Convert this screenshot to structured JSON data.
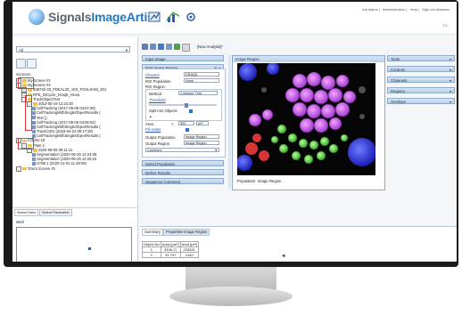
{
  "header": {
    "logo_word1": "Signals",
    "logo_word2": "ImageArtist",
    "top_links": [
      "Job status",
      "Administration",
      "Help",
      "Sign out dhaslam"
    ],
    "user_id": "0.1"
  },
  "left_panel": {
    "dropdown_value": "All",
    "screens_label": "Screens",
    "tree": [
      {
        "level": 0,
        "type": "folder",
        "expanded": true,
        "label": "My Screen #1"
      },
      {
        "level": 0,
        "type": "folder",
        "expanded": true,
        "label": "My Screen #2"
      },
      {
        "level": 1,
        "type": "folder",
        "expanded": false,
        "label": "408732-40_FDEAL20_10X_FOSLKHM_201"
      },
      {
        "level": 1,
        "type": "folder",
        "expanded": false,
        "label": "RPE_DICycle_Draq5_Alexa"
      },
      {
        "level": 1,
        "type": "folder",
        "expanded": true,
        "label": "TrackObjectTest"
      },
      {
        "level": 2,
        "type": "folder",
        "expanded": true,
        "label": "2012-05-19 12:22:20"
      },
      {
        "level": 3,
        "type": "leaf",
        "label": "CellTracking (2017-05-06 04:07:36)"
      },
      {
        "level": 3,
        "type": "leaf",
        "label": "CellTrackingWithSingleObjectResults ("
      },
      {
        "level": 3,
        "type": "leaf",
        "label": "Test ()"
      },
      {
        "level": 3,
        "type": "leaf",
        "label": "CellTracking (2017-05-06 04:06:04)"
      },
      {
        "level": 3,
        "type": "leaf",
        "label": "CellTrackingWithSingleObjectResults ("
      },
      {
        "level": 3,
        "type": "leaf",
        "label": "TrackC001 (2018-04-24 09:17:28)"
      },
      {
        "level": 3,
        "type": "leaf",
        "label": "CellTrackingWithSingleObjectResults ("
      },
      {
        "level": 0,
        "type": "folder",
        "expanded": true,
        "label": "COVID-19"
      },
      {
        "level": 1,
        "type": "folder",
        "expanded": true,
        "label": "Plate 1"
      },
      {
        "level": 2,
        "type": "folder",
        "expanded": true,
        "label": "2020-08-05 09:11:11"
      },
      {
        "level": 3,
        "type": "leaf",
        "label": "Segmentation (2020-06-25 14:24:08"
      },
      {
        "level": 3,
        "type": "leaf",
        "label": "Segmentation (2020-06-25 14:26:15"
      },
      {
        "level": 3,
        "type": "leaf",
        "label": "ST98 1 (2020-12-01 11:48:08)"
      },
      {
        "level": 0,
        "type": "folder",
        "expanded": false,
        "label": "Tiao's Screen #1"
      }
    ],
    "tabs": [
      "Select Data",
      "Select Parameter"
    ],
    "well_label": "Well"
  },
  "middle_panel": {
    "analysis_label": "[New Analysis]*",
    "input_image": "Input Image",
    "find_region": "Find Image Region",
    "channel_label": "Channel",
    "channel_value": "DRAQ5",
    "roi_population_label": "ROI Population",
    "roi_population_value": "None",
    "roi_region_label": "ROI Region",
    "method_label": "Method",
    "method_value": "Common Thre",
    "threshold_label": "Threshold",
    "split_label": "Split Into Objects",
    "area_label": "Area",
    "area_op": ">",
    "area_value": "300",
    "area_unit": "px²",
    "fill_holes_label": "Fill Holes",
    "output_population_label": "Output Population",
    "output_population_value": "Image Region",
    "output_region_label": "Output Region",
    "output_region_value": "Image Region",
    "comment_label": "Comment",
    "select_population": "Select Population",
    "define_results": "Define Results",
    "sequence_comment": "Sequence Comment"
  },
  "image_panel": {
    "title": "Image Region",
    "caption": "Population: Image Region"
  },
  "right_panel": {
    "items": [
      "Tools",
      "Controls",
      "Channels",
      "Regions",
      "Overlays"
    ]
  },
  "summary": {
    "tabs": [
      "Summary",
      "Properties Image Region"
    ],
    "table_headers": [
      "Object No",
      "Area [µm²]",
      "Area [px²]"
    ],
    "rows": [
      [
        "1",
        "3206.17",
        "233521"
      ],
      [
        "2",
        "31.797",
        "1440"
      ]
    ]
  }
}
